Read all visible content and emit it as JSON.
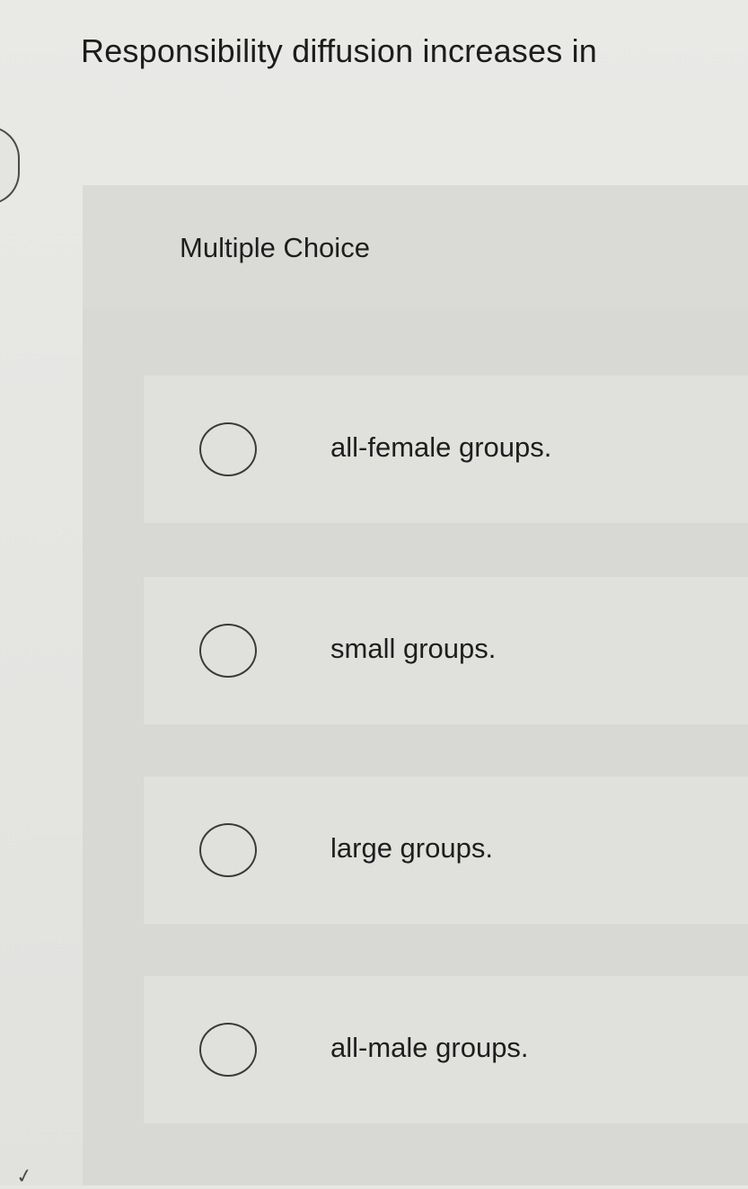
{
  "question": {
    "title": "Responsibility diffusion increases in",
    "type_label": "Multiple Choice"
  },
  "options": [
    {
      "label": "all-female groups.",
      "selected": false
    },
    {
      "label": "small groups.",
      "selected": false
    },
    {
      "label": "large groups.",
      "selected": false
    },
    {
      "label": "all-male groups.",
      "selected": false
    }
  ],
  "icons": {
    "radio": "radio-circle-icon",
    "side_handle": "side-panel-handle-icon",
    "check": "check-mark-icon"
  },
  "colors": {
    "background": "#e6e6e3",
    "panel": "#d8d8d5",
    "option_background": "#e0e0dd",
    "text": "#1e1e1e",
    "radio_border": "#3a3a3a"
  }
}
